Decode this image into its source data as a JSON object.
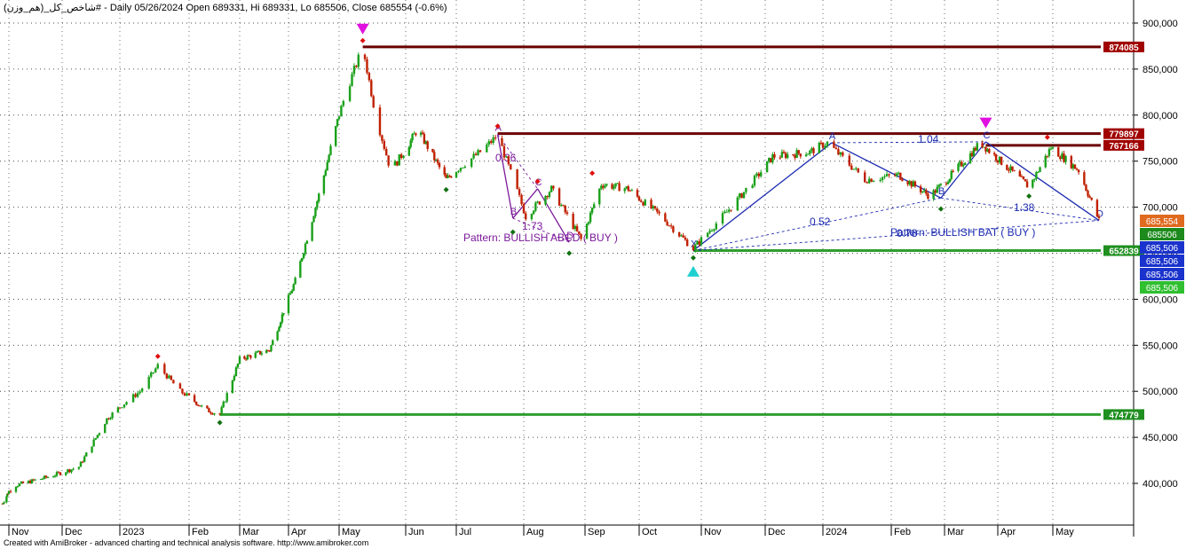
{
  "header": {
    "symbol": "شاخص_کل_(هم_وزن)#",
    "info": " - Daily 05/26/2024 Open 689331, Hi 689331, Lo 685506, Close 685554 (-0.6%)"
  },
  "footer": {
    "credit": "Created with AmiBroker - advanced charting and technical analysis software. http://www.amibroker.com"
  },
  "colors": {
    "up_candle": "#1aa01a",
    "down_candle": "#c02000",
    "resistance_line": "#6b0000",
    "support_line": "#2f9e2f",
    "pattern_line": "#1c2bb0",
    "pattern_text": "#7a1a9a",
    "grid": "#000000"
  },
  "chart_data": {
    "type": "candlestick",
    "ylim": [
      345000,
      915000
    ],
    "x_tick_labels": [
      "Nov",
      "Dec",
      "2023",
      "Feb",
      "Mar",
      "Apr",
      "May",
      "Jun",
      "Jul",
      "Aug",
      "Sep",
      "Oct",
      "Nov",
      "Dec",
      "2024",
      "Feb",
      "Mar",
      "Apr",
      "May"
    ],
    "y_ticks": [
      400000,
      450000,
      500000,
      550000,
      600000,
      650000,
      700000,
      750000,
      800000,
      850000,
      900000
    ],
    "y_tick_labels": [
      "400,000",
      "450,000",
      "500,000",
      "550,000",
      "600,000",
      "650,000",
      "700,000",
      "750,000",
      "800,000",
      "850,000",
      "900,000"
    ],
    "price_path": [
      {
        "date": "2022-10-24",
        "close": 378000
      },
      {
        "date": "2022-11-05",
        "close": 398000
      },
      {
        "date": "2022-11-25",
        "close": 408000
      },
      {
        "date": "2022-12-10",
        "close": 418000
      },
      {
        "date": "2022-12-25",
        "close": 470000
      },
      {
        "date": "2023-01-10",
        "close": 500000
      },
      {
        "date": "2023-01-18",
        "close": 528000
      },
      {
        "date": "2023-01-28",
        "close": 500000
      },
      {
        "date": "2023-02-10",
        "close": 480000
      },
      {
        "date": "2023-02-18",
        "close": 475000
      },
      {
        "date": "2023-03-01",
        "close": 535000
      },
      {
        "date": "2023-03-20",
        "close": 545000
      },
      {
        "date": "2023-04-05",
        "close": 620000
      },
      {
        "date": "2023-04-20",
        "close": 720000
      },
      {
        "date": "2023-05-05",
        "close": 830000
      },
      {
        "date": "2023-05-12",
        "close": 874000
      },
      {
        "date": "2023-05-18",
        "close": 800000
      },
      {
        "date": "2023-05-25",
        "close": 740000
      },
      {
        "date": "2023-06-08",
        "close": 785000
      },
      {
        "date": "2023-06-25",
        "close": 730000
      },
      {
        "date": "2023-07-12",
        "close": 760000
      },
      {
        "date": "2023-07-20",
        "close": 778000
      },
      {
        "date": "2023-08-02",
        "close": 690000
      },
      {
        "date": "2023-08-15",
        "close": 720000
      },
      {
        "date": "2023-08-30",
        "close": 665000
      },
      {
        "date": "2023-09-10",
        "close": 725000
      },
      {
        "date": "2023-09-25",
        "close": 720000
      },
      {
        "date": "2023-10-12",
        "close": 690000
      },
      {
        "date": "2023-10-28",
        "close": 655000
      },
      {
        "date": "2023-11-15",
        "close": 700000
      },
      {
        "date": "2023-12-05",
        "close": 755000
      },
      {
        "date": "2023-12-25",
        "close": 760000
      },
      {
        "date": "2024-01-03",
        "close": 770000
      },
      {
        "date": "2024-01-20",
        "close": 730000
      },
      {
        "date": "2024-02-05",
        "close": 735000
      },
      {
        "date": "2024-02-22",
        "close": 712000
      },
      {
        "date": "2024-03-05",
        "close": 735000
      },
      {
        "date": "2024-03-22",
        "close": 770000
      },
      {
        "date": "2024-04-08",
        "close": 740000
      },
      {
        "date": "2024-04-18",
        "close": 722000
      },
      {
        "date": "2024-04-30",
        "close": 765000
      },
      {
        "date": "2024-05-15",
        "close": 740000
      },
      {
        "date": "2024-05-26",
        "close": 685554
      }
    ],
    "horizontal_levels": [
      {
        "value": 874085,
        "label": "874085",
        "kind": "resistance"
      },
      {
        "value": 779897,
        "label": "779897",
        "kind": "resistance"
      },
      {
        "value": 767166,
        "label": "767166",
        "kind": "resistance"
      },
      {
        "value": 652839,
        "label": "652839",
        "kind": "support"
      },
      {
        "value": 474779,
        "label": "474779",
        "kind": "support"
      }
    ],
    "price_tags": [
      {
        "value": 685554,
        "label": "685,554",
        "color": "#e06a20"
      },
      {
        "value": 685506,
        "label": "685506",
        "color": "#1d8a1d"
      },
      {
        "value": 685506,
        "label": "685,506",
        "color": "#1a33cc"
      },
      {
        "value": 685506,
        "label": "685,506",
        "color": "#1a33cc"
      },
      {
        "value": 685506,
        "label": "685,506",
        "color": "#1a33cc"
      },
      {
        "value": 685506,
        "label": "685,506",
        "color": "#2fbf2f"
      }
    ],
    "patterns": [
      {
        "name": "Pattern: BULLISH ABCD ( BUY )",
        "color": "#7a1a9a",
        "points": [
          {
            "label": "A",
            "date": "2023-07-20",
            "value": 779000
          },
          {
            "label": "B",
            "date": "2023-07-27",
            "value": 688000
          },
          {
            "label": "C",
            "date": "2023-08-08",
            "value": 720000
          },
          {
            "label": "D",
            "date": "2023-08-24",
            "value": 662000
          }
        ],
        "ratios": [
          "0.36",
          "1.73"
        ]
      },
      {
        "name": "Pattern: BULLISH BAT ( BUY )",
        "color": "#1c2bb0",
        "points": [
          {
            "label": "X",
            "date": "2023-10-28",
            "value": 652839
          },
          {
            "label": "A",
            "date": "2024-01-05",
            "value": 770000
          },
          {
            "label": "B",
            "date": "2024-02-28",
            "value": 710000
          },
          {
            "label": "C",
            "date": "2024-03-25",
            "value": 771000
          },
          {
            "label": "D",
            "date": "2024-05-26",
            "value": 685554
          }
        ],
        "ratios": [
          "1.04",
          "0.52",
          "1.38",
          "0.78"
        ]
      }
    ],
    "signals": [
      {
        "type": "sell-arrow",
        "date": "2023-05-12",
        "value": 880000
      },
      {
        "type": "buy-arrow",
        "date": "2023-10-28",
        "value": 640000
      },
      {
        "type": "sell-arrow",
        "date": "2024-03-25",
        "value": 778000
      }
    ]
  }
}
